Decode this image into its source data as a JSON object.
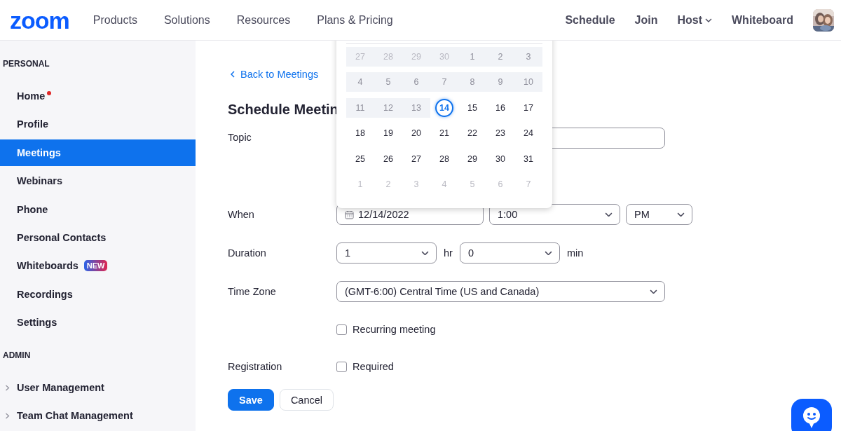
{
  "header": {
    "logo": "zoom",
    "links": [
      {
        "label": "Products"
      },
      {
        "label": "Solutions"
      },
      {
        "label": "Resources"
      },
      {
        "label": "Plans & Pricing"
      }
    ],
    "actions": [
      {
        "label": "Schedule",
        "has_menu": false
      },
      {
        "label": "Join",
        "has_menu": false
      },
      {
        "label": "Host",
        "has_menu": true
      },
      {
        "label": "Whiteboard",
        "has_menu": false
      }
    ]
  },
  "sidebar": [
    {
      "title": "PERSONAL",
      "items": [
        {
          "label": "Home",
          "selected": false,
          "notification": true,
          "expandable": false
        },
        {
          "label": "Profile",
          "selected": false,
          "notification": false,
          "expandable": false
        },
        {
          "label": "Meetings",
          "selected": true,
          "notification": false,
          "expandable": false
        },
        {
          "label": "Webinars",
          "selected": false,
          "notification": false,
          "expandable": false
        },
        {
          "label": "Phone",
          "selected": false,
          "notification": false,
          "expandable": false
        },
        {
          "label": "Personal Contacts",
          "selected": false,
          "notification": false,
          "expandable": false
        },
        {
          "label": "Whiteboards",
          "selected": false,
          "notification": false,
          "expandable": false,
          "badge": "NEW"
        },
        {
          "label": "Recordings",
          "selected": false,
          "notification": false,
          "expandable": false
        },
        {
          "label": "Settings",
          "selected": false,
          "notification": false,
          "expandable": false
        }
      ]
    },
    {
      "title": "ADMIN",
      "items": [
        {
          "label": "User Management",
          "selected": false,
          "notification": false,
          "expandable": true
        },
        {
          "label": "Team Chat Management",
          "selected": false,
          "notification": false,
          "expandable": true
        }
      ]
    }
  ],
  "form": {
    "back_link": "Back to Meetings",
    "title": "Schedule Meetin",
    "topic": {
      "label": "Topic"
    },
    "when": {
      "label": "When",
      "date": "12/14/2022",
      "time": "1:00",
      "period": "PM"
    },
    "duration": {
      "label": "Duration",
      "hours": "1",
      "hours_unit": "hr",
      "minutes": "0",
      "minutes_unit": "min"
    },
    "time_zone": {
      "label": "Time Zone",
      "value": "(GMT-6:00) Central Time (US and Canada)"
    },
    "recurring": {
      "label": "Recurring meeting",
      "checked": false
    },
    "registration": {
      "label": "Registration",
      "option": "Required",
      "checked": false
    },
    "buttons": [
      {
        "label": "Save",
        "kind": "primary"
      },
      {
        "label": "Cancel",
        "kind": "secondary"
      }
    ]
  },
  "calendar": {
    "weeks": [
      [
        {
          "day": "27",
          "outside": true,
          "past": true,
          "selected": false
        },
        {
          "day": "28",
          "outside": true,
          "past": true,
          "selected": false
        },
        {
          "day": "29",
          "outside": true,
          "past": true,
          "selected": false
        },
        {
          "day": "30",
          "outside": true,
          "past": true,
          "selected": false
        },
        {
          "day": "1",
          "outside": false,
          "past": true,
          "selected": false
        },
        {
          "day": "2",
          "outside": false,
          "past": true,
          "selected": false
        },
        {
          "day": "3",
          "outside": false,
          "past": true,
          "selected": false
        }
      ],
      [
        {
          "day": "4",
          "outside": false,
          "past": true,
          "selected": false
        },
        {
          "day": "5",
          "outside": false,
          "past": true,
          "selected": false
        },
        {
          "day": "6",
          "outside": false,
          "past": true,
          "selected": false
        },
        {
          "day": "7",
          "outside": false,
          "past": true,
          "selected": false
        },
        {
          "day": "8",
          "outside": false,
          "past": true,
          "selected": false
        },
        {
          "day": "9",
          "outside": false,
          "past": true,
          "selected": false
        },
        {
          "day": "10",
          "outside": false,
          "past": true,
          "selected": false
        }
      ],
      [
        {
          "day": "11",
          "outside": false,
          "past": true,
          "selected": false
        },
        {
          "day": "12",
          "outside": false,
          "past": true,
          "selected": false
        },
        {
          "day": "13",
          "outside": false,
          "past": true,
          "selected": false
        },
        {
          "day": "14",
          "outside": false,
          "past": false,
          "selected": true
        },
        {
          "day": "15",
          "outside": false,
          "past": false,
          "selected": false
        },
        {
          "day": "16",
          "outside": false,
          "past": false,
          "selected": false
        },
        {
          "day": "17",
          "outside": false,
          "past": false,
          "selected": false
        }
      ],
      [
        {
          "day": "18",
          "outside": false,
          "past": false,
          "selected": false
        },
        {
          "day": "19",
          "outside": false,
          "past": false,
          "selected": false
        },
        {
          "day": "20",
          "outside": false,
          "past": false,
          "selected": false
        },
        {
          "day": "21",
          "outside": false,
          "past": false,
          "selected": false
        },
        {
          "day": "22",
          "outside": false,
          "past": false,
          "selected": false
        },
        {
          "day": "23",
          "outside": false,
          "past": false,
          "selected": false
        },
        {
          "day": "24",
          "outside": false,
          "past": false,
          "selected": false
        }
      ],
      [
        {
          "day": "25",
          "outside": false,
          "past": false,
          "selected": false
        },
        {
          "day": "26",
          "outside": false,
          "past": false,
          "selected": false
        },
        {
          "day": "27",
          "outside": false,
          "past": false,
          "selected": false
        },
        {
          "day": "28",
          "outside": false,
          "past": false,
          "selected": false
        },
        {
          "day": "29",
          "outside": false,
          "past": false,
          "selected": false
        },
        {
          "day": "30",
          "outside": false,
          "past": false,
          "selected": false
        },
        {
          "day": "31",
          "outside": false,
          "past": false,
          "selected": false
        }
      ],
      [
        {
          "day": "1",
          "outside": true,
          "past": false,
          "selected": false
        },
        {
          "day": "2",
          "outside": true,
          "past": false,
          "selected": false
        },
        {
          "day": "3",
          "outside": true,
          "past": false,
          "selected": false
        },
        {
          "day": "4",
          "outside": true,
          "past": false,
          "selected": false
        },
        {
          "day": "5",
          "outside": true,
          "past": false,
          "selected": false
        },
        {
          "day": "6",
          "outside": true,
          "past": false,
          "selected": false
        },
        {
          "day": "7",
          "outside": true,
          "past": false,
          "selected": false
        }
      ]
    ]
  }
}
